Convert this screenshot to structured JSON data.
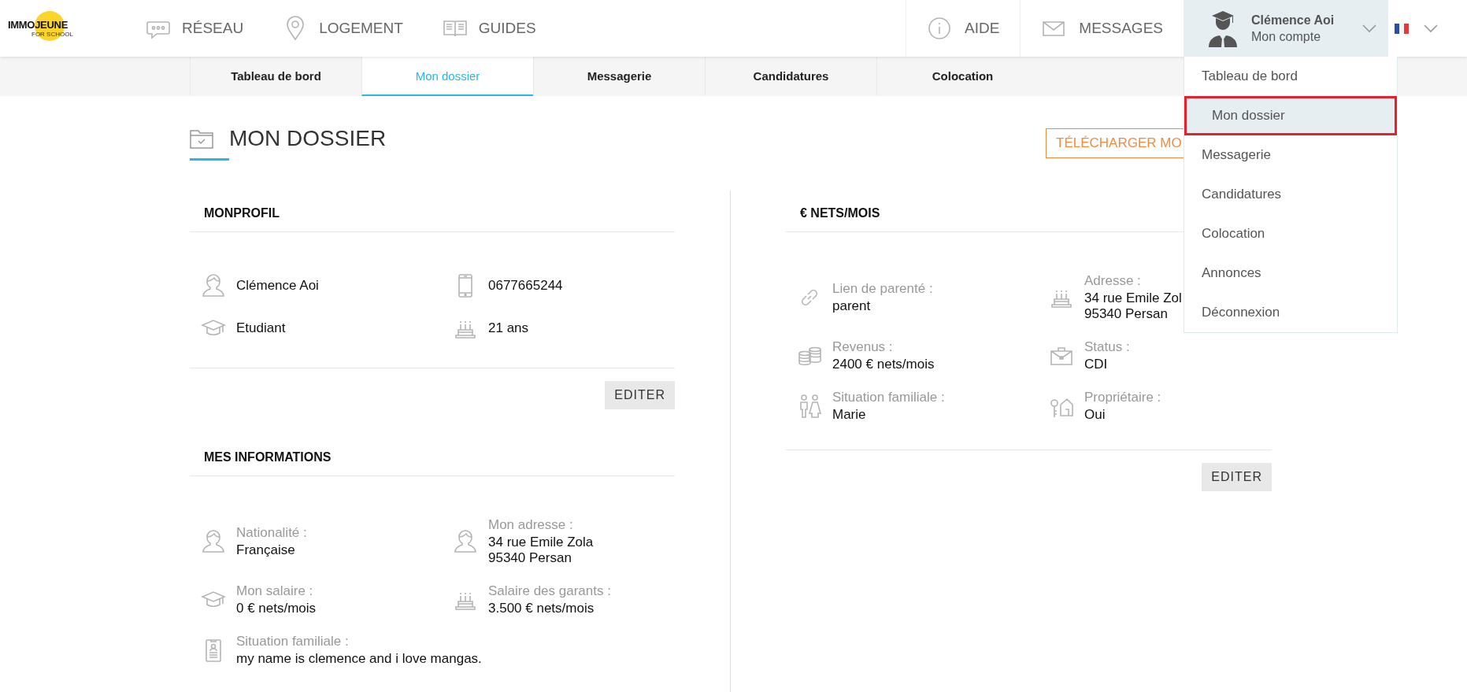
{
  "logo": {
    "name": "IMMOJEUNE",
    "tagline": "FOR SCHOOL"
  },
  "nav": [
    {
      "label": "RÉSEAU"
    },
    {
      "label": "LOGEMENT"
    },
    {
      "label": "GUIDES"
    }
  ],
  "top_links": [
    {
      "label": "AIDE"
    },
    {
      "label": "MESSAGES"
    }
  ],
  "account": {
    "name": "Clémence Aoi",
    "subtitle": "Mon compte",
    "expanded": true,
    "menu": [
      {
        "label": "Tableau de bord",
        "selected": false
      },
      {
        "label": "Mon dossier",
        "selected": true
      },
      {
        "label": "Messagerie",
        "selected": false
      },
      {
        "label": "Candidatures",
        "selected": false
      },
      {
        "label": "Colocation",
        "selected": false
      },
      {
        "label": "Annonces",
        "selected": false
      },
      {
        "label": "Déconnexion",
        "selected": false
      }
    ]
  },
  "tabs": [
    {
      "label": "Tableau de bord",
      "selected": false
    },
    {
      "label": "Mon dossier",
      "selected": true
    },
    {
      "label": "Messagerie",
      "selected": false
    },
    {
      "label": "Candidatures",
      "selected": false
    },
    {
      "label": "Colocation",
      "selected": false
    }
  ],
  "page": {
    "title": "MON DOSSIER",
    "download_button": "TÉLÉCHARGER MO"
  },
  "columns": [
    {
      "sections": [
        {
          "title": "MONPROFIL",
          "items": [
            {
              "value": "Clémence Aoi"
            },
            {
              "value": "0677665244"
            },
            {
              "value": "Etudiant"
            },
            {
              "value": "21 ans"
            }
          ],
          "button": "EDITER"
        },
        {
          "title": "MES INFORMATIONS",
          "items": [
            {
              "label": "Nationalité :",
              "value": "Française"
            },
            {
              "label": "Mon adresse :",
              "value": "34 rue Emile Zola\n95340 Persan"
            },
            {
              "label": "Mon salaire :",
              "value": "0 € nets/mois"
            },
            {
              "label": "Salaire des garants :",
              "value": "3.500 € nets/mois"
            },
            {
              "label": "Situation familiale :",
              "value": "my name is clemence and i love mangas."
            }
          ]
        }
      ]
    },
    {
      "sections": [
        {
          "title": "€ NETS/MOIS",
          "items": [
            {
              "label": "Lien de parenté :",
              "value": "parent"
            },
            {
              "label": "Adresse :",
              "value": "34 rue Emile Zol\n95340 Persan"
            },
            {
              "label": "Revenus :",
              "value": "2400 € nets/mois"
            },
            {
              "label": "Status :",
              "value": "CDI"
            },
            {
              "label": "Situation familiale :",
              "value": "Marie"
            },
            {
              "label": "Propriétaire :",
              "value": "Oui"
            }
          ],
          "button": "EDITER"
        }
      ]
    }
  ]
}
